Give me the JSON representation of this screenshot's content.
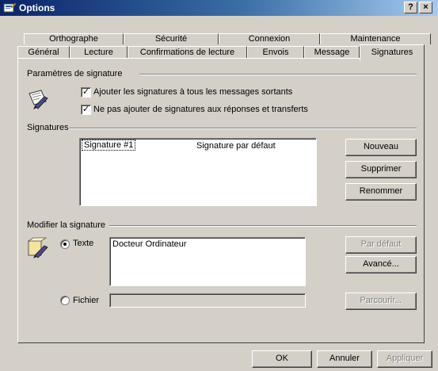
{
  "window": {
    "title": "Options",
    "help_label": "?",
    "close_label": "×"
  },
  "tabs": {
    "row_back": [
      "Orthographe",
      "Sécurité",
      "Connexion",
      "Maintenance"
    ],
    "row_front": [
      "Général",
      "Lecture",
      "Confirmations de lecture",
      "Envois",
      "Message",
      "Signatures"
    ],
    "active": "Signatures"
  },
  "settings_group": {
    "title": "Paramètres de signature",
    "add_to_all": "Ajouter les signatures à tous les messages sortants",
    "add_to_all_checked": true,
    "no_replies": "Ne pas ajouter de signatures aux réponses et transferts",
    "no_replies_checked": true,
    "check_mark": "✓"
  },
  "signatures_group": {
    "title": "Signatures",
    "items": [
      {
        "name": "Signature #1",
        "status": "Signature par défaut"
      }
    ],
    "buttons": {
      "new": "Nouveau",
      "delete": "Supprimer",
      "rename": "Renommer"
    }
  },
  "edit_group": {
    "title": "Modifier la signature",
    "text_option": "Texte",
    "text_selected": true,
    "text_value": "Docteur Ordinateur",
    "file_option": "Fichier",
    "file_value": "",
    "buttons": {
      "default": "Par défaut",
      "advanced": "Avancé...",
      "browse": "Parcourir..."
    }
  },
  "footer": {
    "ok": "OK",
    "cancel": "Annuler",
    "apply": "Appliquer"
  }
}
